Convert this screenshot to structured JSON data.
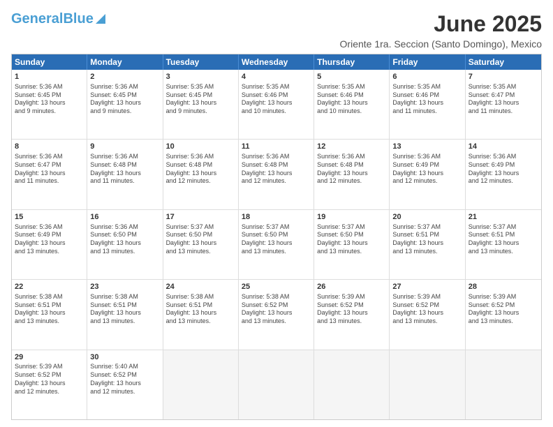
{
  "logo": {
    "line1": "General",
    "line2": "Blue"
  },
  "title": "June 2025",
  "subtitle": "Oriente 1ra. Seccion (Santo Domingo), Mexico",
  "header_days": [
    "Sunday",
    "Monday",
    "Tuesday",
    "Wednesday",
    "Thursday",
    "Friday",
    "Saturday"
  ],
  "weeks": [
    [
      {
        "day": "1",
        "lines": [
          "Sunrise: 5:36 AM",
          "Sunset: 6:45 PM",
          "Daylight: 13 hours",
          "and 9 minutes."
        ]
      },
      {
        "day": "2",
        "lines": [
          "Sunrise: 5:36 AM",
          "Sunset: 6:45 PM",
          "Daylight: 13 hours",
          "and 9 minutes."
        ]
      },
      {
        "day": "3",
        "lines": [
          "Sunrise: 5:35 AM",
          "Sunset: 6:45 PM",
          "Daylight: 13 hours",
          "and 9 minutes."
        ]
      },
      {
        "day": "4",
        "lines": [
          "Sunrise: 5:35 AM",
          "Sunset: 6:46 PM",
          "Daylight: 13 hours",
          "and 10 minutes."
        ]
      },
      {
        "day": "5",
        "lines": [
          "Sunrise: 5:35 AM",
          "Sunset: 6:46 PM",
          "Daylight: 13 hours",
          "and 10 minutes."
        ]
      },
      {
        "day": "6",
        "lines": [
          "Sunrise: 5:35 AM",
          "Sunset: 6:46 PM",
          "Daylight: 13 hours",
          "and 11 minutes."
        ]
      },
      {
        "day": "7",
        "lines": [
          "Sunrise: 5:35 AM",
          "Sunset: 6:47 PM",
          "Daylight: 13 hours",
          "and 11 minutes."
        ]
      }
    ],
    [
      {
        "day": "8",
        "lines": [
          "Sunrise: 5:36 AM",
          "Sunset: 6:47 PM",
          "Daylight: 13 hours",
          "and 11 minutes."
        ]
      },
      {
        "day": "9",
        "lines": [
          "Sunrise: 5:36 AM",
          "Sunset: 6:48 PM",
          "Daylight: 13 hours",
          "and 11 minutes."
        ]
      },
      {
        "day": "10",
        "lines": [
          "Sunrise: 5:36 AM",
          "Sunset: 6:48 PM",
          "Daylight: 13 hours",
          "and 12 minutes."
        ]
      },
      {
        "day": "11",
        "lines": [
          "Sunrise: 5:36 AM",
          "Sunset: 6:48 PM",
          "Daylight: 13 hours",
          "and 12 minutes."
        ]
      },
      {
        "day": "12",
        "lines": [
          "Sunrise: 5:36 AM",
          "Sunset: 6:48 PM",
          "Daylight: 13 hours",
          "and 12 minutes."
        ]
      },
      {
        "day": "13",
        "lines": [
          "Sunrise: 5:36 AM",
          "Sunset: 6:49 PM",
          "Daylight: 13 hours",
          "and 12 minutes."
        ]
      },
      {
        "day": "14",
        "lines": [
          "Sunrise: 5:36 AM",
          "Sunset: 6:49 PM",
          "Daylight: 13 hours",
          "and 12 minutes."
        ]
      }
    ],
    [
      {
        "day": "15",
        "lines": [
          "Sunrise: 5:36 AM",
          "Sunset: 6:49 PM",
          "Daylight: 13 hours",
          "and 13 minutes."
        ]
      },
      {
        "day": "16",
        "lines": [
          "Sunrise: 5:36 AM",
          "Sunset: 6:50 PM",
          "Daylight: 13 hours",
          "and 13 minutes."
        ]
      },
      {
        "day": "17",
        "lines": [
          "Sunrise: 5:37 AM",
          "Sunset: 6:50 PM",
          "Daylight: 13 hours",
          "and 13 minutes."
        ]
      },
      {
        "day": "18",
        "lines": [
          "Sunrise: 5:37 AM",
          "Sunset: 6:50 PM",
          "Daylight: 13 hours",
          "and 13 minutes."
        ]
      },
      {
        "day": "19",
        "lines": [
          "Sunrise: 5:37 AM",
          "Sunset: 6:50 PM",
          "Daylight: 13 hours",
          "and 13 minutes."
        ]
      },
      {
        "day": "20",
        "lines": [
          "Sunrise: 5:37 AM",
          "Sunset: 6:51 PM",
          "Daylight: 13 hours",
          "and 13 minutes."
        ]
      },
      {
        "day": "21",
        "lines": [
          "Sunrise: 5:37 AM",
          "Sunset: 6:51 PM",
          "Daylight: 13 hours",
          "and 13 minutes."
        ]
      }
    ],
    [
      {
        "day": "22",
        "lines": [
          "Sunrise: 5:38 AM",
          "Sunset: 6:51 PM",
          "Daylight: 13 hours",
          "and 13 minutes."
        ]
      },
      {
        "day": "23",
        "lines": [
          "Sunrise: 5:38 AM",
          "Sunset: 6:51 PM",
          "Daylight: 13 hours",
          "and 13 minutes."
        ]
      },
      {
        "day": "24",
        "lines": [
          "Sunrise: 5:38 AM",
          "Sunset: 6:51 PM",
          "Daylight: 13 hours",
          "and 13 minutes."
        ]
      },
      {
        "day": "25",
        "lines": [
          "Sunrise: 5:38 AM",
          "Sunset: 6:52 PM",
          "Daylight: 13 hours",
          "and 13 minutes."
        ]
      },
      {
        "day": "26",
        "lines": [
          "Sunrise: 5:39 AM",
          "Sunset: 6:52 PM",
          "Daylight: 13 hours",
          "and 13 minutes."
        ]
      },
      {
        "day": "27",
        "lines": [
          "Sunrise: 5:39 AM",
          "Sunset: 6:52 PM",
          "Daylight: 13 hours",
          "and 13 minutes."
        ]
      },
      {
        "day": "28",
        "lines": [
          "Sunrise: 5:39 AM",
          "Sunset: 6:52 PM",
          "Daylight: 13 hours",
          "and 13 minutes."
        ]
      }
    ],
    [
      {
        "day": "29",
        "lines": [
          "Sunrise: 5:39 AM",
          "Sunset: 6:52 PM",
          "Daylight: 13 hours",
          "and 12 minutes."
        ]
      },
      {
        "day": "30",
        "lines": [
          "Sunrise: 5:40 AM",
          "Sunset: 6:52 PM",
          "Daylight: 13 hours",
          "and 12 minutes."
        ]
      },
      {
        "day": "",
        "lines": []
      },
      {
        "day": "",
        "lines": []
      },
      {
        "day": "",
        "lines": []
      },
      {
        "day": "",
        "lines": []
      },
      {
        "day": "",
        "lines": []
      }
    ]
  ]
}
